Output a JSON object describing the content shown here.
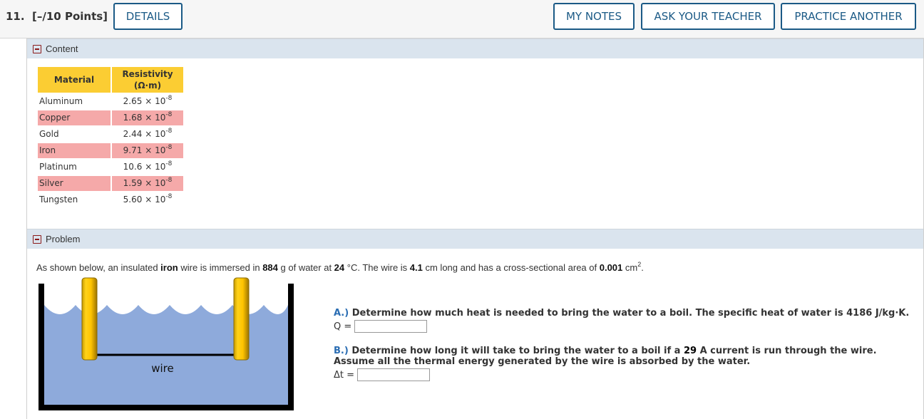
{
  "header": {
    "question_number": "11.",
    "points": "[–/10 Points]",
    "buttons": {
      "details": "DETAILS",
      "my_notes": "MY NOTES",
      "ask_teacher": "ASK YOUR TEACHER",
      "practice_another": "PRACTICE ANOTHER"
    },
    "accent_color": "#1b5a86"
  },
  "content_section": {
    "title": "Content",
    "table": {
      "headers": [
        "Material",
        "Resistivity",
        "(Ω·m)"
      ],
      "rows": [
        {
          "material": "Aluminum",
          "mantissa": "2.65 × 10",
          "exponent": "-8",
          "highlight": false
        },
        {
          "material": "Copper",
          "mantissa": "1.68 × 10",
          "exponent": "-8",
          "highlight": true
        },
        {
          "material": "Gold",
          "mantissa": "2.44 × 10",
          "exponent": "-8",
          "highlight": false
        },
        {
          "material": "Iron",
          "mantissa": "9.71 × 10",
          "exponent": "-8",
          "highlight": true
        },
        {
          "material": "Platinum",
          "mantissa": "10.6 × 10",
          "exponent": "-8",
          "highlight": false
        },
        {
          "material": "Silver",
          "mantissa": "1.59 × 10",
          "exponent": "-8",
          "highlight": true
        },
        {
          "material": "Tungsten",
          "mantissa": "5.60 × 10",
          "exponent": "-8",
          "highlight": false
        }
      ],
      "header_color": "#fbcd33",
      "highlight_color": "#f5a9a9"
    }
  },
  "problem_section": {
    "title": "Problem",
    "intro": {
      "t1": "As shown below, an insulated ",
      "material": "iron",
      "t2": " wire is immersed in ",
      "mass": "884",
      "t3": " g of water at ",
      "temp": "24",
      "t4": " °C. The wire is ",
      "length": "4.1",
      "t5": " cm long and has a cross-sectional area of ",
      "area": "0.001",
      "t6": " cm",
      "area_exp": "2",
      "t7": "."
    },
    "figure": {
      "wire_label": "wire"
    },
    "parts": [
      {
        "label": "A.)",
        "text": " Determine how much heat is needed to bring the water to a boil. The specific heat of water is 4186 J/kg·K.",
        "answer_label": "Q =",
        "answer_value": ""
      },
      {
        "label": "B.)",
        "text_before": " Determine how long it will take to bring the water to a boil if a ",
        "current": "29",
        "text_after": " A current is run through the wire.",
        "text_line2": "Assume all the thermal energy generated by the wire is absorbed by the water.",
        "answer_label": "Δt =",
        "answer_value": ""
      }
    ]
  }
}
